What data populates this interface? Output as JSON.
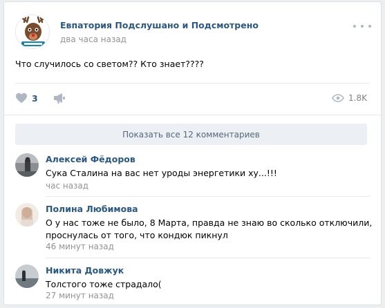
{
  "post": {
    "group_name": "Евпатория Подслушано и Подсмотрено",
    "time": "два часа назад",
    "text": "Что случилось со светом?? Кто знает????",
    "likes": "3",
    "views": "1.8K",
    "show_all_comments": "Показать все 12 комментариев"
  },
  "comments": [
    {
      "author": "Алексей Фёдоров",
      "lines": [
        "Сука Сталина на вас нет уроды энергетики ху...!!!"
      ],
      "time": "час назад"
    },
    {
      "author": "Полина Любимова",
      "lines": [
        "О у нас тоже не было, 8 Марта, правда не знаю во сколько отключили,",
        "проснулась от того, что кондюк пикнул"
      ],
      "time": "46 минут назад"
    },
    {
      "author": "Никита Довжук",
      "lines": [
        "Толстого тоже страдало("
      ],
      "time": "27 минут назад"
    }
  ],
  "colors": {
    "link": "#2a5885",
    "muted": "#939393",
    "icon": "#aeb7c2"
  },
  "icons": {
    "like": "heart-icon",
    "share": "megaphone-icon",
    "views": "eye-icon",
    "more": "more-dots-icon"
  }
}
